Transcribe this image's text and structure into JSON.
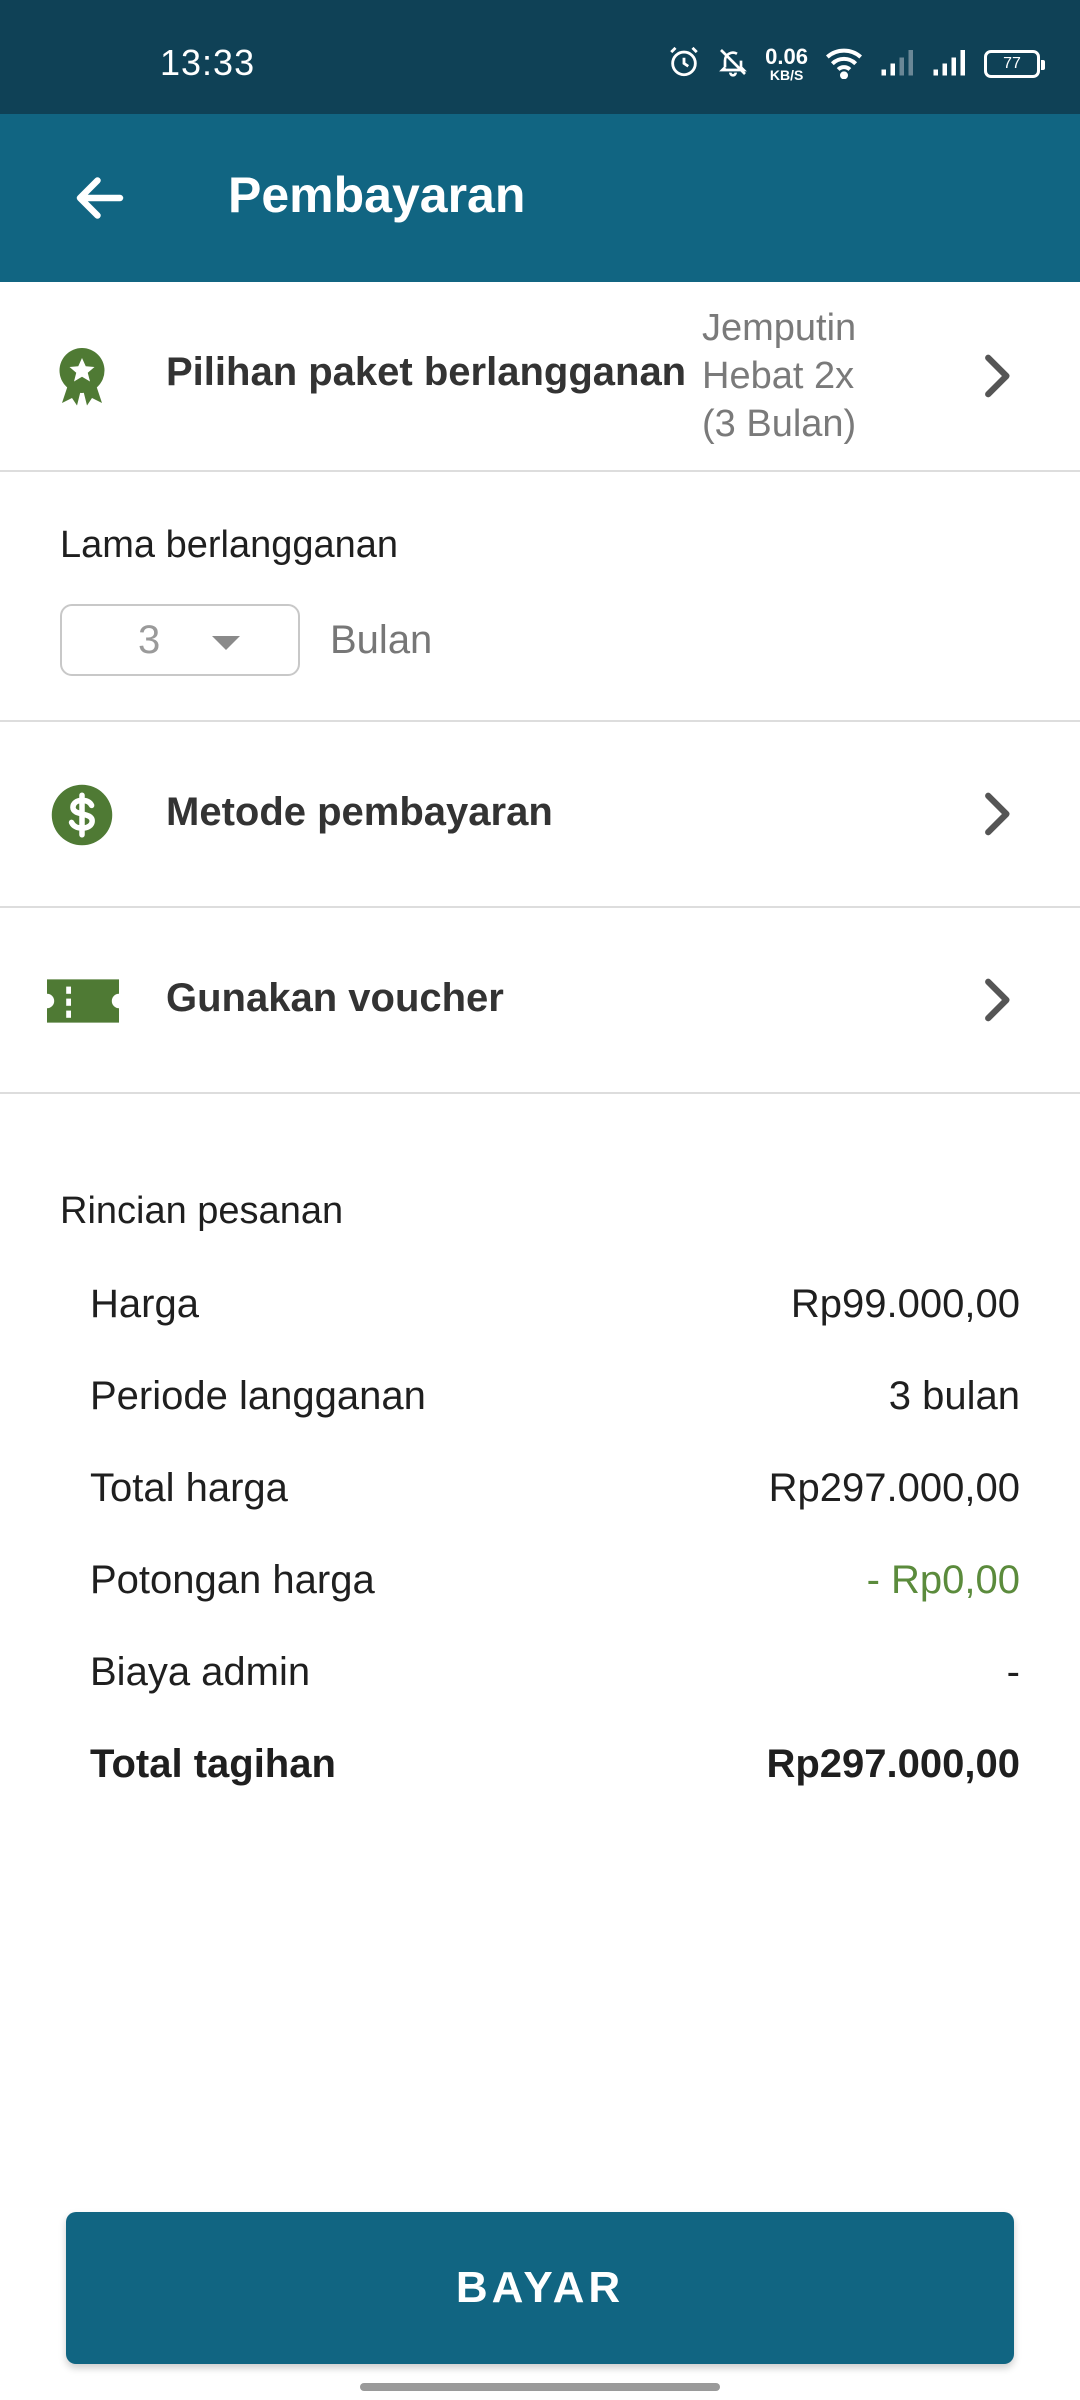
{
  "status_bar": {
    "time": "13:33",
    "net_speed_value": "0.06",
    "net_speed_unit": "KB/S",
    "battery": "77",
    "icons": [
      "alarm-icon",
      "bell-off-icon",
      "wifi-icon",
      "signal-icon",
      "signal-icon",
      "battery-icon"
    ]
  },
  "app_bar": {
    "title": "Pembayaran",
    "back_icon": "arrow-left-icon"
  },
  "subscription_plan": {
    "label": "Pilihan paket berlangganan",
    "value_lines": [
      "Jemputin",
      "Hebat 2x",
      "(3 Bulan)"
    ],
    "icon": "award-ribbon-icon",
    "icon_color": "#4f7a34"
  },
  "duration": {
    "label": "Lama berlangganan",
    "selected": "3",
    "unit": "Bulan"
  },
  "payment_method": {
    "label": "Metode pembayaran",
    "icon": "dollar-circle-icon",
    "icon_color": "#4f7a34"
  },
  "voucher": {
    "label": "Gunakan voucher",
    "icon": "ticket-icon",
    "icon_color": "#4f7a34"
  },
  "order_summary": {
    "title": "Rincian pesanan",
    "rows": [
      {
        "label": "Harga",
        "value": "Rp99.000,00"
      },
      {
        "label": "Periode langganan",
        "value": "3 bulan"
      },
      {
        "label": "Total harga",
        "value": "Rp297.000,00"
      },
      {
        "label": "Potongan harga",
        "value": "- Rp0,00"
      },
      {
        "label": "Biaya admin",
        "value": "-"
      },
      {
        "label": "Total tagihan",
        "value": "Rp297.000,00"
      }
    ]
  },
  "pay_button": {
    "label": "BAYAR"
  },
  "colors": {
    "status_bar": "#0f4156",
    "primary": "#116582",
    "accent_green": "#4f7a34",
    "discount_green": "#5b8b3c"
  }
}
